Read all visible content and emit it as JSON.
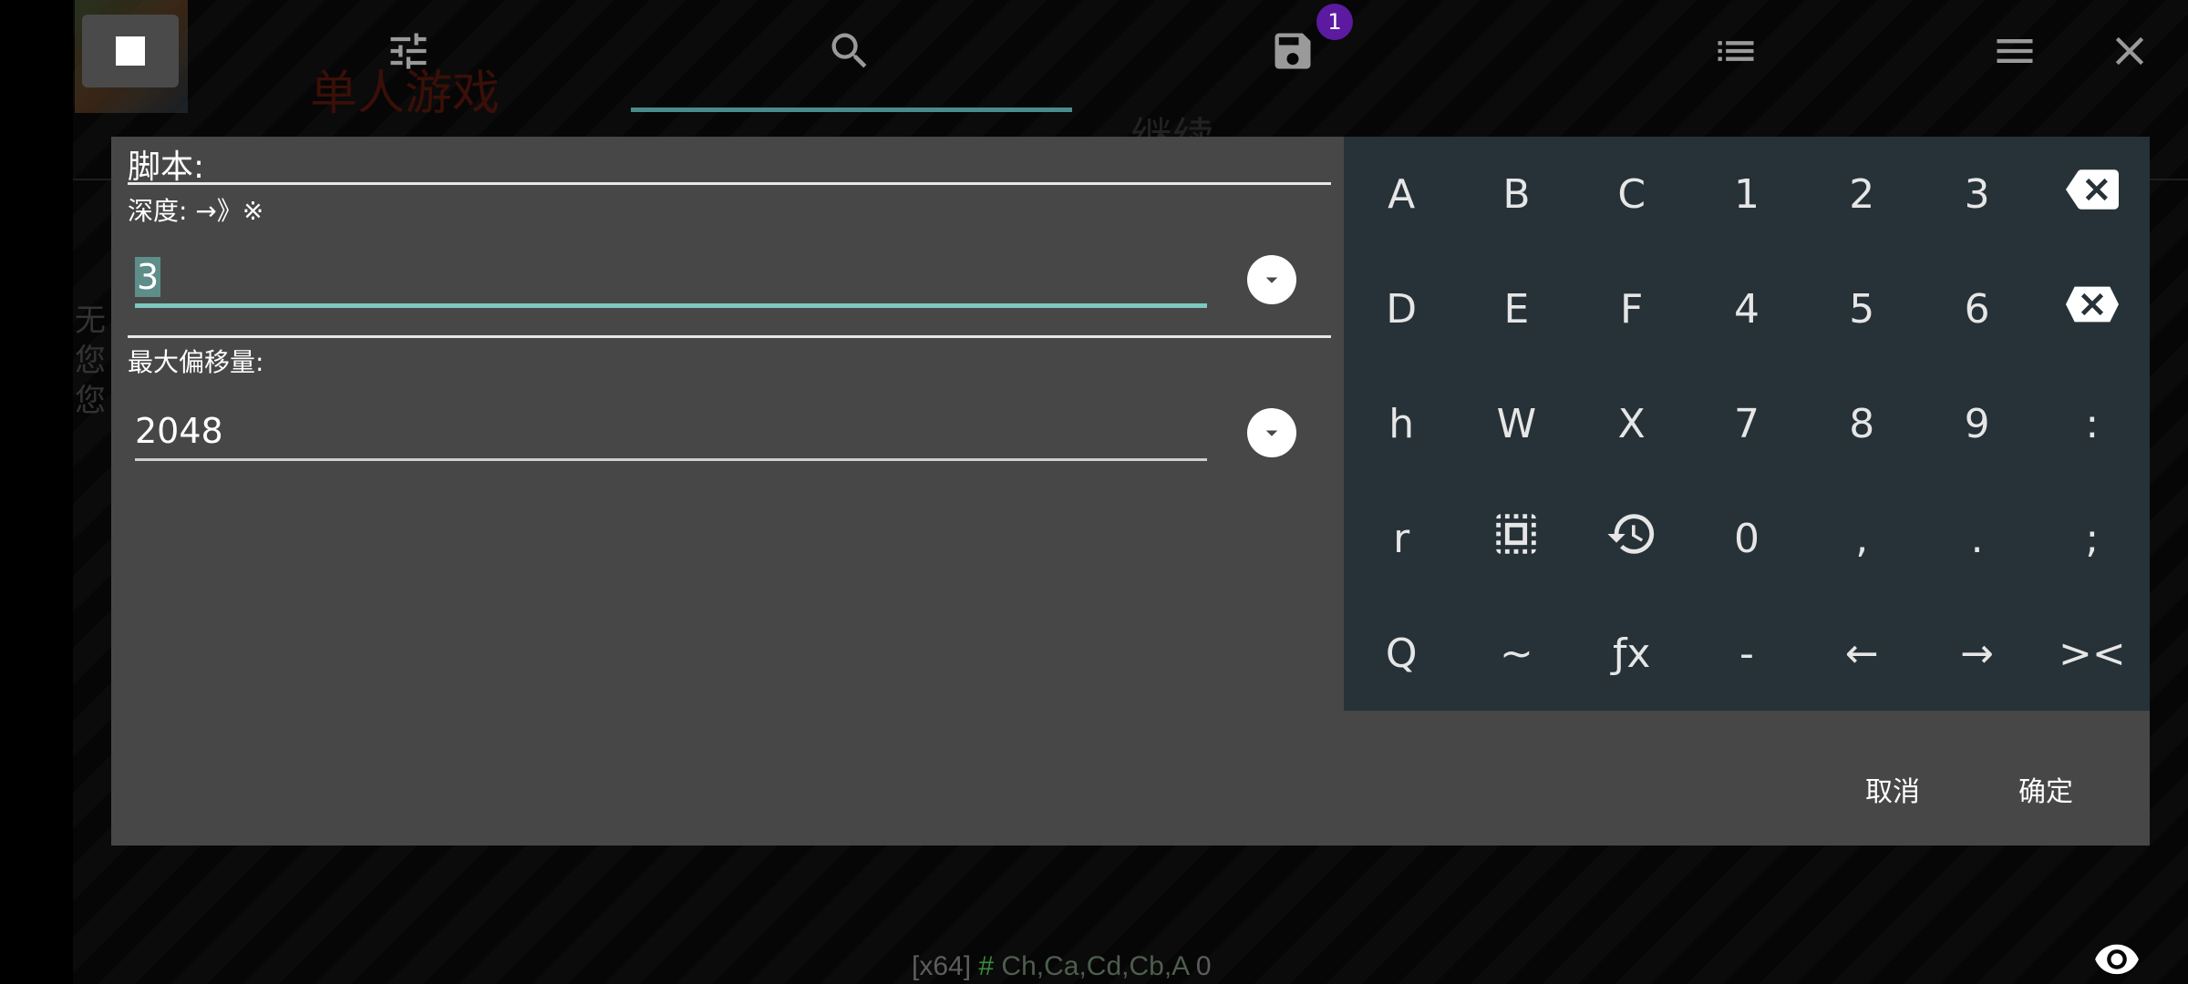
{
  "background": {
    "game_title": "单人游戏",
    "continue_label": "继续",
    "side_text": [
      "无",
      "您",
      "您"
    ]
  },
  "toolbar": {
    "icons": [
      "stop-icon",
      "tune-icon",
      "search-icon",
      "save-icon",
      "list-icon",
      "menu-icon",
      "close-icon"
    ],
    "save_badge": "1",
    "accent": "#4a8c8c"
  },
  "dialog": {
    "script_label": "脚本:",
    "depth_label": "深度: →》※",
    "depth_value": "3",
    "offset_label": "最大偏移量:",
    "offset_value": "2048",
    "cancel_label": "取消",
    "ok_label": "确定"
  },
  "keypad": {
    "rows": [
      [
        "A",
        "B",
        "C",
        "1",
        "2",
        "3",
        "{backspace}"
      ],
      [
        "D",
        "E",
        "F",
        "4",
        "5",
        "6",
        "{clear}"
      ],
      [
        "h",
        "W",
        "X",
        "7",
        "8",
        "9",
        ":"
      ],
      [
        "r",
        "{select-all}",
        "{history}",
        "0",
        ",",
        ".",
        ";"
      ],
      [
        "Q",
        "~",
        "ƒx",
        "-",
        "←",
        "→",
        "><"
      ]
    ],
    "background_color": "#263238"
  },
  "status": {
    "arch": "[x64]",
    "hash": "#",
    "regs": "Ch,Ca,Cd,Cb,A",
    "count": "0"
  }
}
